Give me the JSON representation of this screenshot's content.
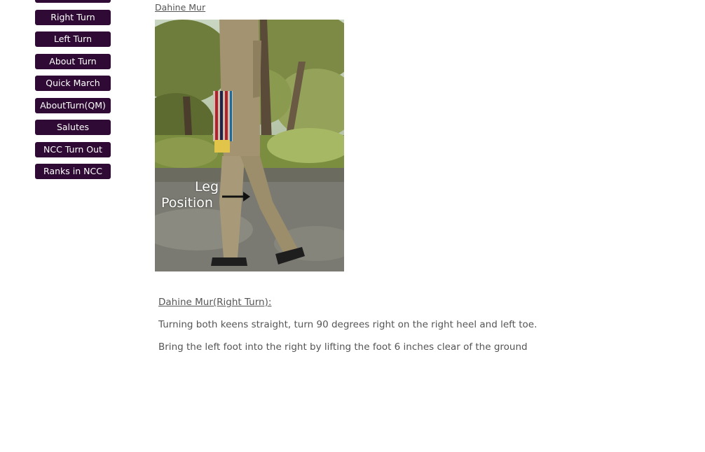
{
  "nav": {
    "items": [
      {
        "label": ""
      },
      {
        "label": "Right Turn"
      },
      {
        "label": "Left Turn"
      },
      {
        "label": "About Turn"
      },
      {
        "label": "Quick March"
      },
      {
        "label": "AboutTurn(QM)"
      },
      {
        "label": "Salutes"
      },
      {
        "label": "NCC Turn Out"
      },
      {
        "label": "Ranks in NCC"
      }
    ]
  },
  "content": {
    "breadcrumb": "Dahine Mur",
    "image": {
      "label_line1": "Leg",
      "label_line2": "Position",
      "arrow_icon": "right-arrow-icon"
    },
    "heading": "Dahine Mur(Right Turn):",
    "paragraphs": [
      "Turning both keens straight, turn 90 degrees right on the right heel and left toe.",
      "Bring the left foot into the right by lifting the foot 6 inches clear of the ground"
    ]
  },
  "colors": {
    "nav_bg": "#2e0a34",
    "nav_text": "#ffffff",
    "body_text": "#555555"
  }
}
